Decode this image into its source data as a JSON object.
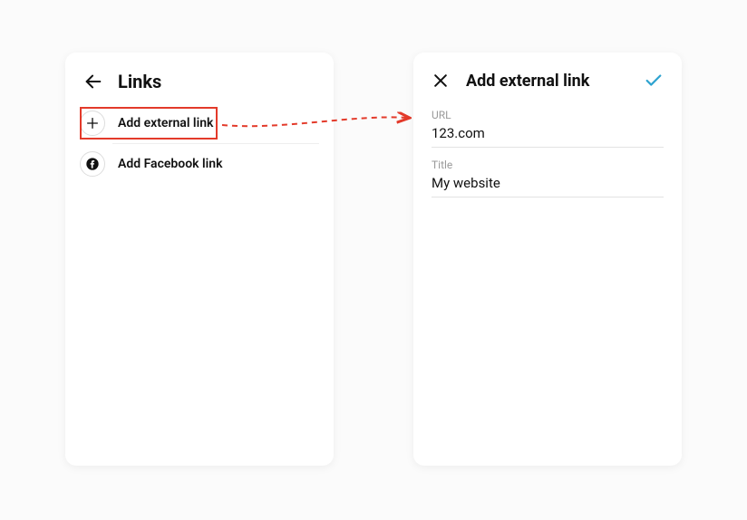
{
  "left": {
    "title": "Links",
    "rows": [
      {
        "label": "Add external link"
      },
      {
        "label": "Add Facebook link"
      }
    ]
  },
  "right": {
    "title": "Add external link",
    "url_label": "URL",
    "url_value": "123.com",
    "title_label": "Title",
    "title_value": "My website"
  },
  "colors": {
    "highlight": "#e33a2a",
    "accent": "#2ea3d0"
  }
}
